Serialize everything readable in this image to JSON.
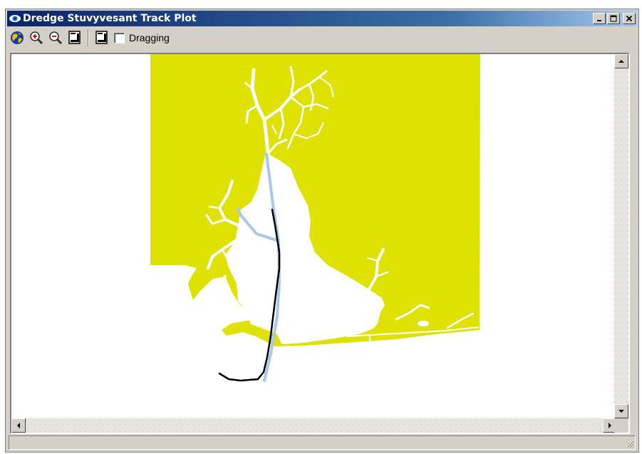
{
  "window": {
    "title": "Dredge Stuvyvesant Track Plot"
  },
  "toolbar": {
    "buttons": [
      {
        "name": "globe-icon"
      },
      {
        "name": "zoom-in-icon"
      },
      {
        "name": "zoom-out-icon"
      },
      {
        "name": "document-icon"
      },
      {
        "name": "document-icon"
      }
    ],
    "dragging_label": "Dragging",
    "dragging_checked": false
  },
  "map": {
    "land_color": "#dfe200",
    "water_color": "#ffffff",
    "channel_color": "#a9c9ec",
    "track_color": "#000000"
  },
  "icons": {
    "app": "eye-icon",
    "minimize": "minimize-icon",
    "maximize": "maximize-icon",
    "close": "close-icon"
  },
  "status": {
    "text": ""
  }
}
